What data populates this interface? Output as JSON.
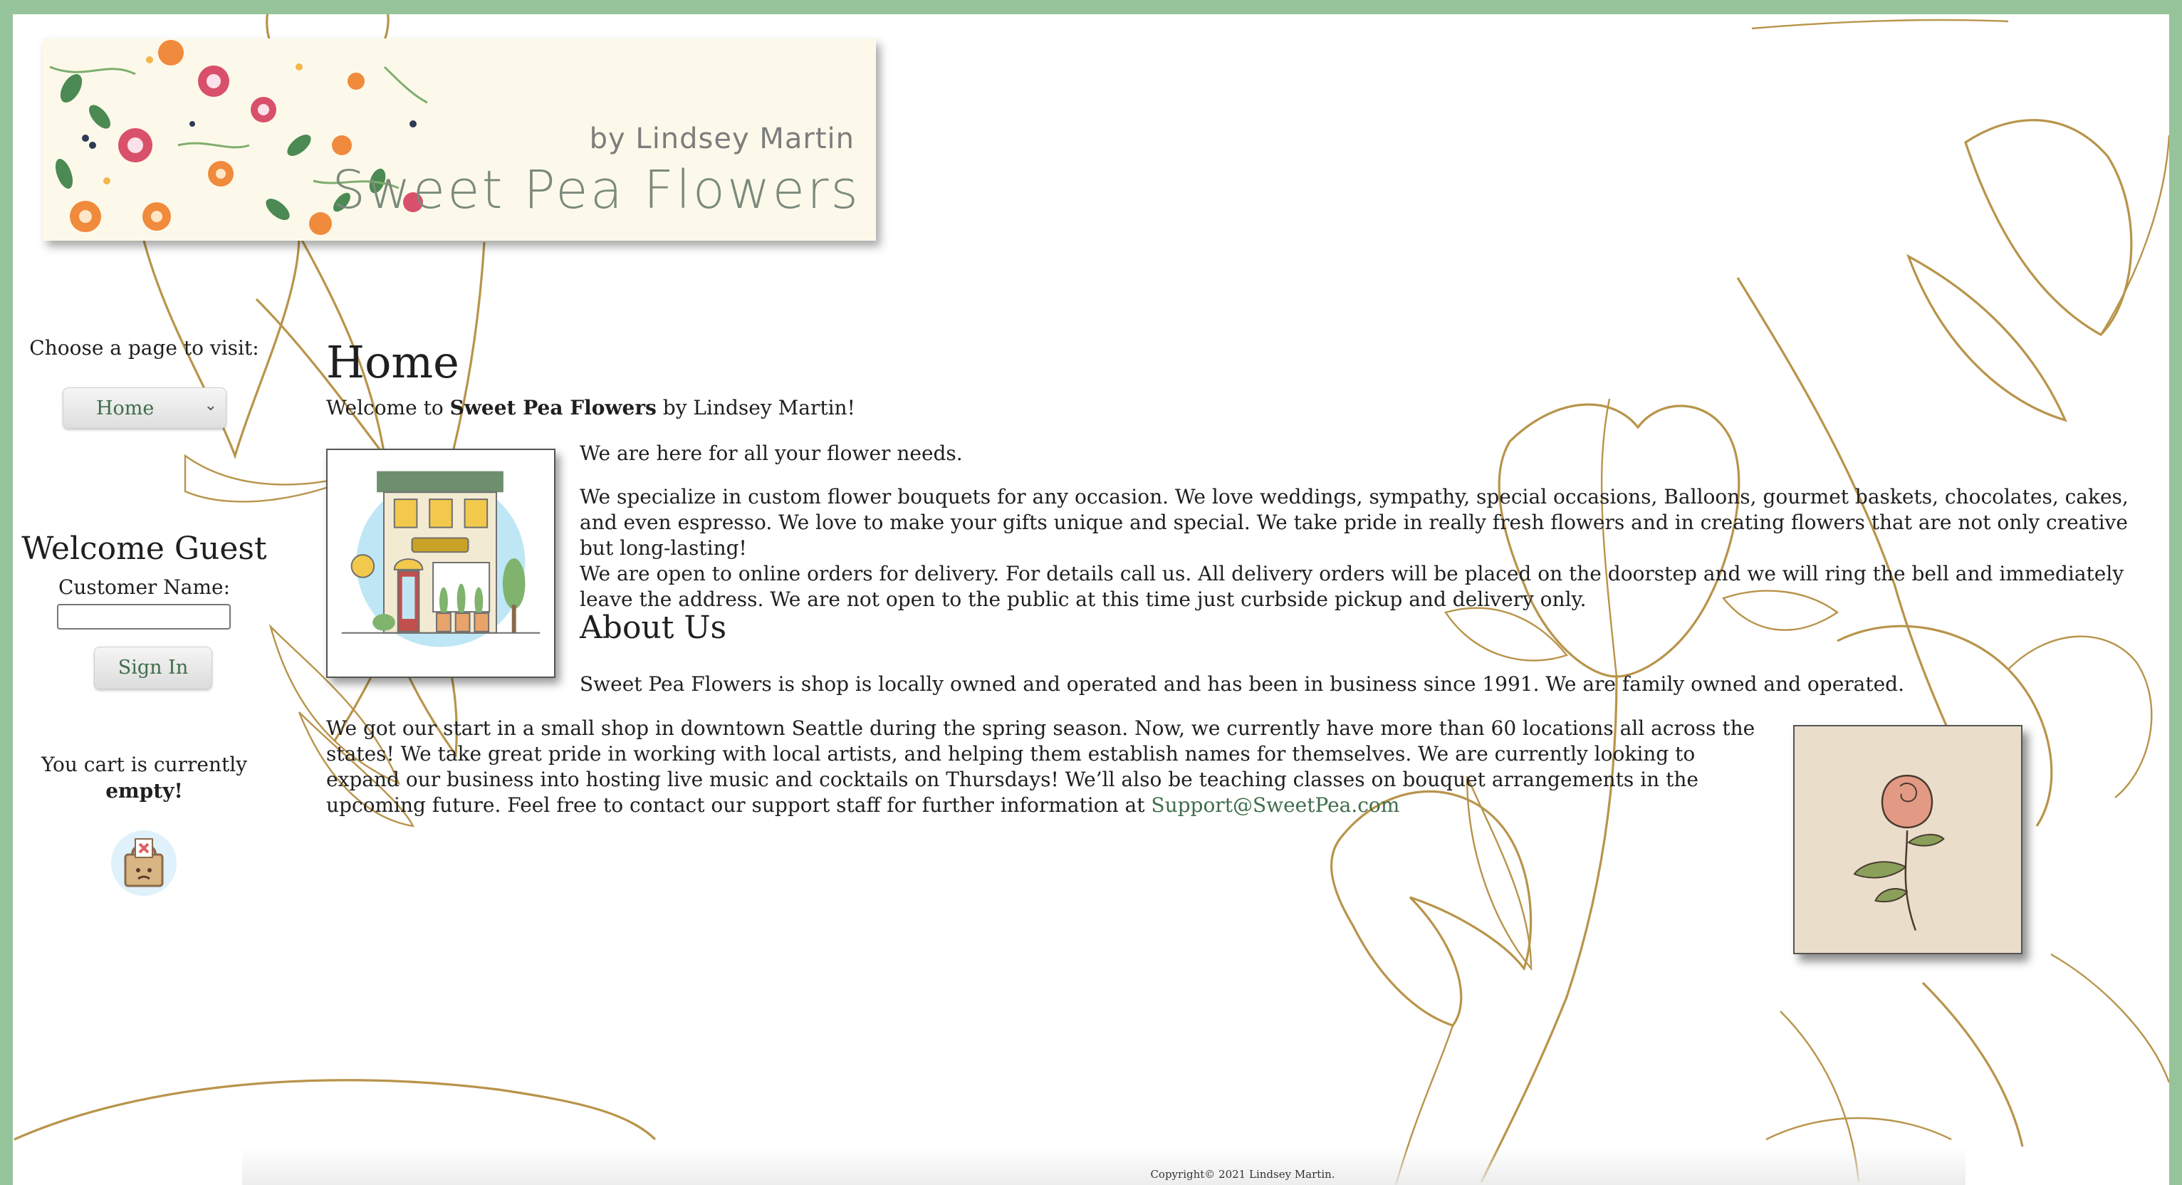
{
  "banner": {
    "subtitle": "by Lindsey Martin",
    "title": "Sweet Pea Flowers"
  },
  "sidebar": {
    "choose_label": "Choose a page to visit:",
    "page_select": {
      "selected": "Home"
    },
    "welcome": "Welcome Guest",
    "customer_label": "Customer Name:",
    "customer_input_value": "",
    "signin_label": "Sign In",
    "cart_text": "You cart is currently",
    "cart_status": "empty!"
  },
  "main": {
    "heading": "Home",
    "welcome_pre": "Welcome to ",
    "welcome_brand": "Sweet Pea Flowers",
    "welcome_post": " by Lindsey Martin!",
    "intro": "We are here for all your flower needs.",
    "specialize": "We specialize in custom flower bouquets for any occasion. We love weddings, sympathy, special occasions, Balloons, gourmet baskets, chocolates, cakes, and even espresso. We love to make your gifts unique and special. We take pride in really fresh flowers and in creating flowers that are not only creative but long-lasting!",
    "delivery": "We are open to online orders for delivery. For details call us. All delivery orders will be placed on the doorstep and we will ring the bell and immediately leave the address. We are not open to the public at this time just curbside pickup and delivery only.",
    "about_heading": "About Us",
    "about_text": "Sweet Pea Flowers is shop is locally owned and operated and has been in business since 1991. We are family owned and operated.",
    "start_text": "We got our start in a small shop in downtown Seattle during the spring season. Now, we currently have more than 60 locations all across the states! We take great pride in working with local artists, and helping them establish names for themselves. We are currently looking to expand our business into hosting live music and cocktails on Thursdays! We’ll also be teaching classes on bouquet arrangements in the upcoming future. Feel free to contact our support staff for further information at ",
    "support_email": "Support@SweetPea.com"
  },
  "footer": {
    "copyright": "Copyright© 2021 Lindsey Martin."
  },
  "colors": {
    "frame": "#96c49a",
    "link": "#3f6d4a",
    "line_art": "#b8944a",
    "rose_bg": "#eaddca"
  },
  "icons": {
    "cart": "shopping-bag-icon",
    "florist": "florist-shop-illustration",
    "rose": "rose-illustration",
    "select": "chevron-down-icon"
  }
}
